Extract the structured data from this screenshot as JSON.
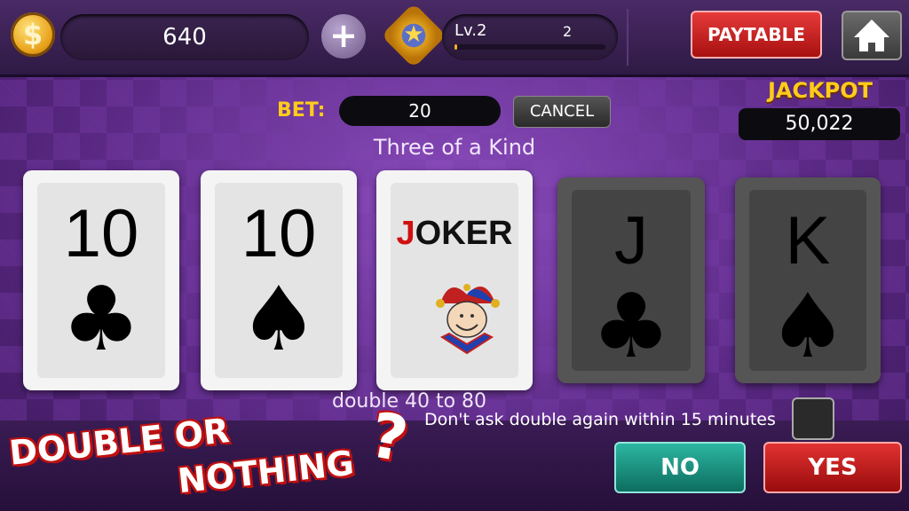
{
  "topbar": {
    "coin_symbol": "$",
    "coins": "640",
    "plus_symbol": "+",
    "level_label": "Lv.2",
    "level_value": "2",
    "level_progress": 0.02,
    "paytable_label": "PAYTABLE"
  },
  "bet": {
    "label": "BET:",
    "value": "20",
    "cancel_label": "CANCEL"
  },
  "jackpot": {
    "label": "JACKPOT",
    "value": "50,022"
  },
  "hand_result": "Three of a Kind",
  "cards": [
    {
      "rank": "10",
      "suit": "♣"
    },
    {
      "rank": "10",
      "suit": "♠"
    },
    {
      "joker_first": "J",
      "joker_rest": "OKER"
    },
    {
      "rank": "J",
      "suit": "♣"
    },
    {
      "rank": "K",
      "suit": "♠"
    }
  ],
  "double_prompt": "double 40 to 80",
  "dont_ask": "Don't ask double again within 15 minutes",
  "buttons": {
    "no": "NO",
    "yes": "YES"
  },
  "promo": {
    "line1": "DOUBLE OR",
    "line2": "NOTHING",
    "mark": "?"
  },
  "colors": {
    "accent_gold": "#ffcc1a",
    "no_teal": "#2cb6a2",
    "yes_red": "#e23232"
  }
}
